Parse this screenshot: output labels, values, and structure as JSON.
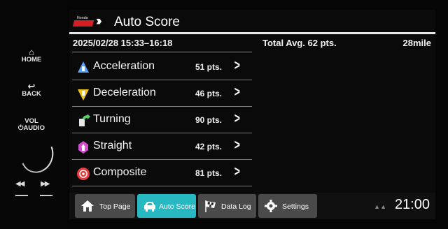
{
  "hardware": {
    "home": "HOME",
    "back": "BACK",
    "vol": "VOL",
    "audio": "AUDIO"
  },
  "header": {
    "logo_small": "Honda",
    "title": "Auto Score"
  },
  "summary": {
    "date_range": "2025/02/28 15:33–16:18",
    "total_avg": "Total Avg. 62 pts.",
    "distance": "28mile"
  },
  "scores": [
    {
      "label": "Acceleration",
      "points": "51 pts.",
      "icon": "acceleration-icon",
      "color": "#5aa0ff"
    },
    {
      "label": "Deceleration",
      "points": "46 pts.",
      "icon": "deceleration-icon",
      "color": "#f0c419"
    },
    {
      "label": "Turning",
      "points": "90 pts.",
      "icon": "turning-icon",
      "color": "#55d060"
    },
    {
      "label": "Straight",
      "points": "42 pts.",
      "icon": "straight-icon",
      "color": "#d24bd0"
    },
    {
      "label": "Composite",
      "points": "81 pts.",
      "icon": "composite-icon",
      "color": "#e83a3a"
    }
  ],
  "tabs": [
    {
      "label": "Top Page",
      "icon": "home-icon",
      "active": false
    },
    {
      "label": "Auto Score",
      "icon": "car-icon",
      "active": true
    },
    {
      "label": "Data Log",
      "icon": "checkered-flag-icon",
      "active": false
    },
    {
      "label": "Settings",
      "icon": "gear-icon",
      "active": false
    }
  ],
  "status": {
    "clock": "21:00"
  },
  "colors": {
    "accent": "#28b8c2",
    "tab_bg": "#4a4a4a"
  }
}
